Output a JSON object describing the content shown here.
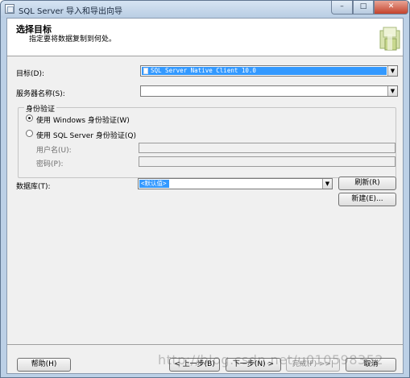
{
  "window": {
    "title": "SQL Server 导入和导出向导",
    "caption_minimize": "–",
    "caption_maximize": "□",
    "caption_close": "✕"
  },
  "header": {
    "title": "选择目标",
    "subtitle": "指定要将数据复制到何处。"
  },
  "form": {
    "destination_label": "目标(D):",
    "destination_value": "SQL Server Native Client 10.0",
    "server_label": "服务器名称(S):",
    "server_value": "",
    "auth_group_label": "身份验证",
    "auth_windows_label": "使用 Windows 身份验证(W)",
    "auth_sql_label": "使用 SQL Server 身份验证(Q)",
    "auth_selected": "windows",
    "username_label": "用户名(U):",
    "password_label": "密码(P):",
    "database_label": "数据库(T):",
    "database_value": "<默认值>",
    "refresh_button": "刷新(R)",
    "new_button": "新建(E)..."
  },
  "footer": {
    "help_button": "帮助(H)",
    "back_button": "< 上一步(B)",
    "next_button": "下一步(N) >",
    "finish_button": "完成(F) >>|",
    "cancel_button": "取消"
  },
  "watermark": "http://blog.csdn.net/u010598352"
}
